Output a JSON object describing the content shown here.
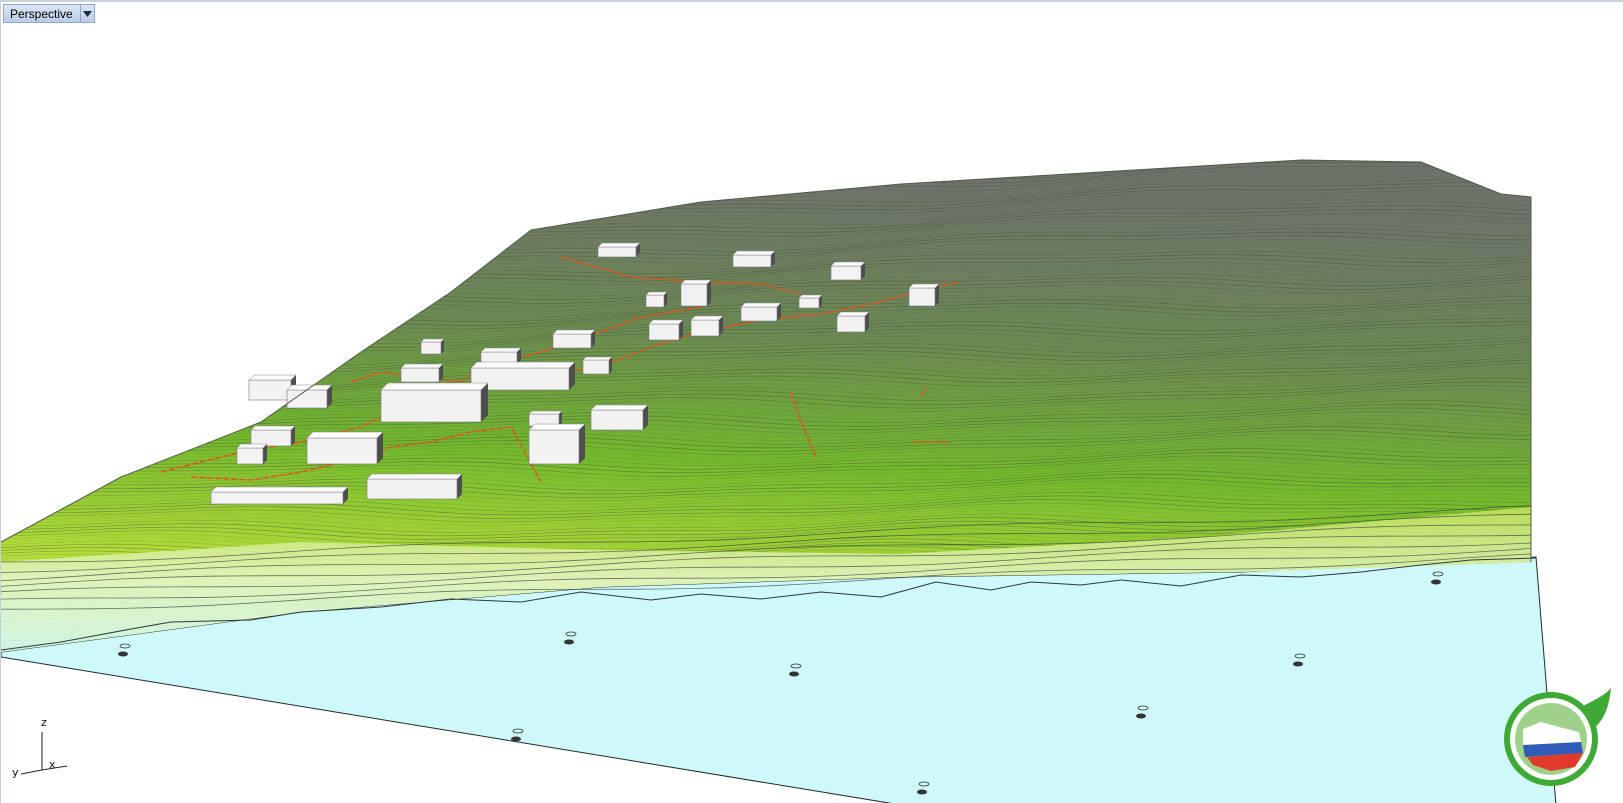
{
  "viewport": {
    "name": "Perspective",
    "menu_icon": "dropdown-triangle-icon"
  },
  "axes": {
    "z": "z",
    "y": "y",
    "x": "x"
  },
  "colors": {
    "terrain_low": "#bfe04a",
    "terrain_mid": "#6fbf2a",
    "terrain_high": "#6e7a66",
    "contour_line": "#3f4a3a",
    "water": "#cff8fb",
    "road": "#e0541e",
    "building_top": "#f2f2f2",
    "building_side": "#9a9a9a"
  },
  "logo": {
    "icon": "eco-russia-map-leaf-logo"
  }
}
